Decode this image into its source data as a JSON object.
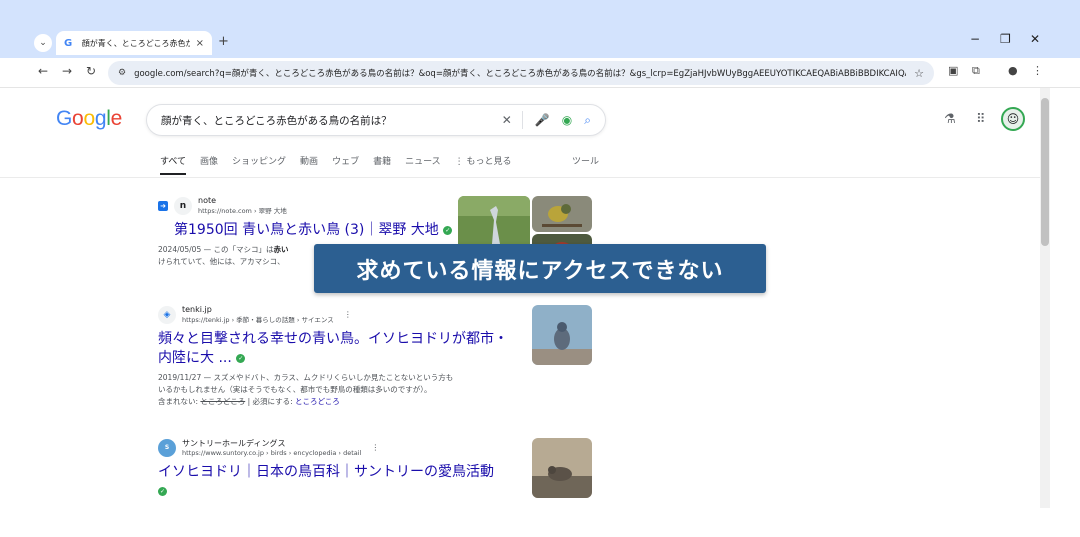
{
  "browser": {
    "tab": {
      "favicon": "G",
      "title": "顔が青く、ところどころ赤色がある鳥",
      "close": "×"
    },
    "new_tab": "+",
    "window_controls": {
      "minimize": "−",
      "restore": "❐",
      "close": "✕"
    },
    "nav": {
      "back": "←",
      "forward": "→",
      "reload": "↻"
    },
    "url": "google.com/search?q=顔が青く、ところどころ赤色がある鳥の名前は？&oq=顔が青く、ところどころ赤色がある鳥の名前は？&gs_lcrp=EgZjaHJvbWUyBggAEEUYOTIKCAEQABiABBiBBDIKCAIQABiABBii...",
    "icons": {
      "site_info": "site-settings-icon",
      "star": "bookmark-star-icon",
      "ext": "extensions-icon",
      "profile": "profile-icon",
      "menu": "kebab-menu-icon"
    }
  },
  "google": {
    "logo_letters": [
      "G",
      "o",
      "o",
      "g",
      "l",
      "e"
    ],
    "search_query": "顔が青く、ところどころ赤色がある鳥の名前は？",
    "filters": [
      "すべて",
      "画像",
      "ショッピング",
      "動画",
      "ウェブ",
      "書籍",
      "ニュース",
      "⋮ もっと見る"
    ],
    "tools": "ツール"
  },
  "results": [
    {
      "site_name": "note",
      "site_url": "https://note.com › 翠野 大地",
      "favicon": "n",
      "title": "第1950回 青い鳥と赤い鳥 (3)｜翠野 大地",
      "snippet_date": "2024/05/05 — この「マシコ」は",
      "snippet_bold": "赤い",
      "snippet_rest": "",
      "snippet_line2": "けられていて、他には、アカマシコ、"
    },
    {
      "site_name": "tenki.jp",
      "site_url": "https://tenki.jp › 季節・暮らしの話題 › サイエンス",
      "favicon": "◈",
      "title": "頻々と目撃される幸せの青い鳥。イソヒヨドリが都市・内陸に大 ...",
      "snippet_line1": "2019/11/27 — スズメやドバト、カラス、ムクドリくらいしか見たことないという方も",
      "snippet_line2": "いるかもしれません（実はそうでもなく、都市でも野鳥の種類は多いのですが）。",
      "missing_label": "含まれない: ",
      "missing_struck": "ところどころ",
      "must_include": " | 必須にする: ",
      "must_link": "ところどころ"
    },
    {
      "site_name": "サントリーホールディングス",
      "site_url": "https://www.suntory.co.jp › birds › encyclopedia › detail",
      "favicon": "S",
      "title": "イソヒヨドリ｜日本の鳥百科｜サントリーの愛鳥活動"
    }
  ],
  "overlay": {
    "message": "求めている情報にアクセスできない"
  }
}
